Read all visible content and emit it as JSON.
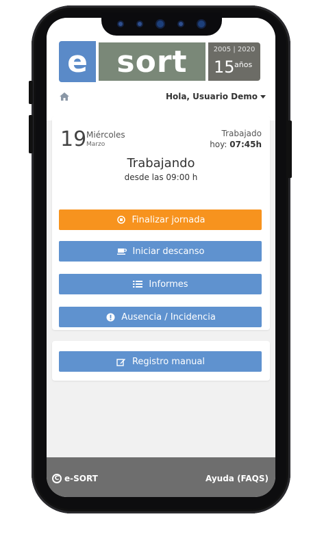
{
  "logo": {
    "letter": "e",
    "word": "sort",
    "years_range": "2005 | 2020",
    "years_count": "15",
    "years_label": "años"
  },
  "nav": {
    "home_icon": "home-icon",
    "greeting": "Hola, Usuario Demo"
  },
  "date": {
    "day": "19",
    "weekday": "Miércoles",
    "month": "Marzo"
  },
  "worked": {
    "label": "Trabajado",
    "prefix": "hoy:",
    "value": "07:45h"
  },
  "status": {
    "title": "Trabajando",
    "since": "desde las 09:00 h"
  },
  "actions": {
    "end_shift": "Finalizar jornada",
    "start_break": "Iniciar descanso",
    "reports": "Informes",
    "absence": "Ausencia / Incidencia",
    "manual_entry": "Registro manual"
  },
  "footer": {
    "copyright": "e-SORT",
    "help": "Ayuda (FAQS)"
  },
  "colors": {
    "accent_orange": "#f7931e",
    "button_blue": "#5f92cf",
    "logo_blue": "#5a8ac8",
    "footer_gray": "#6e6e6e"
  }
}
